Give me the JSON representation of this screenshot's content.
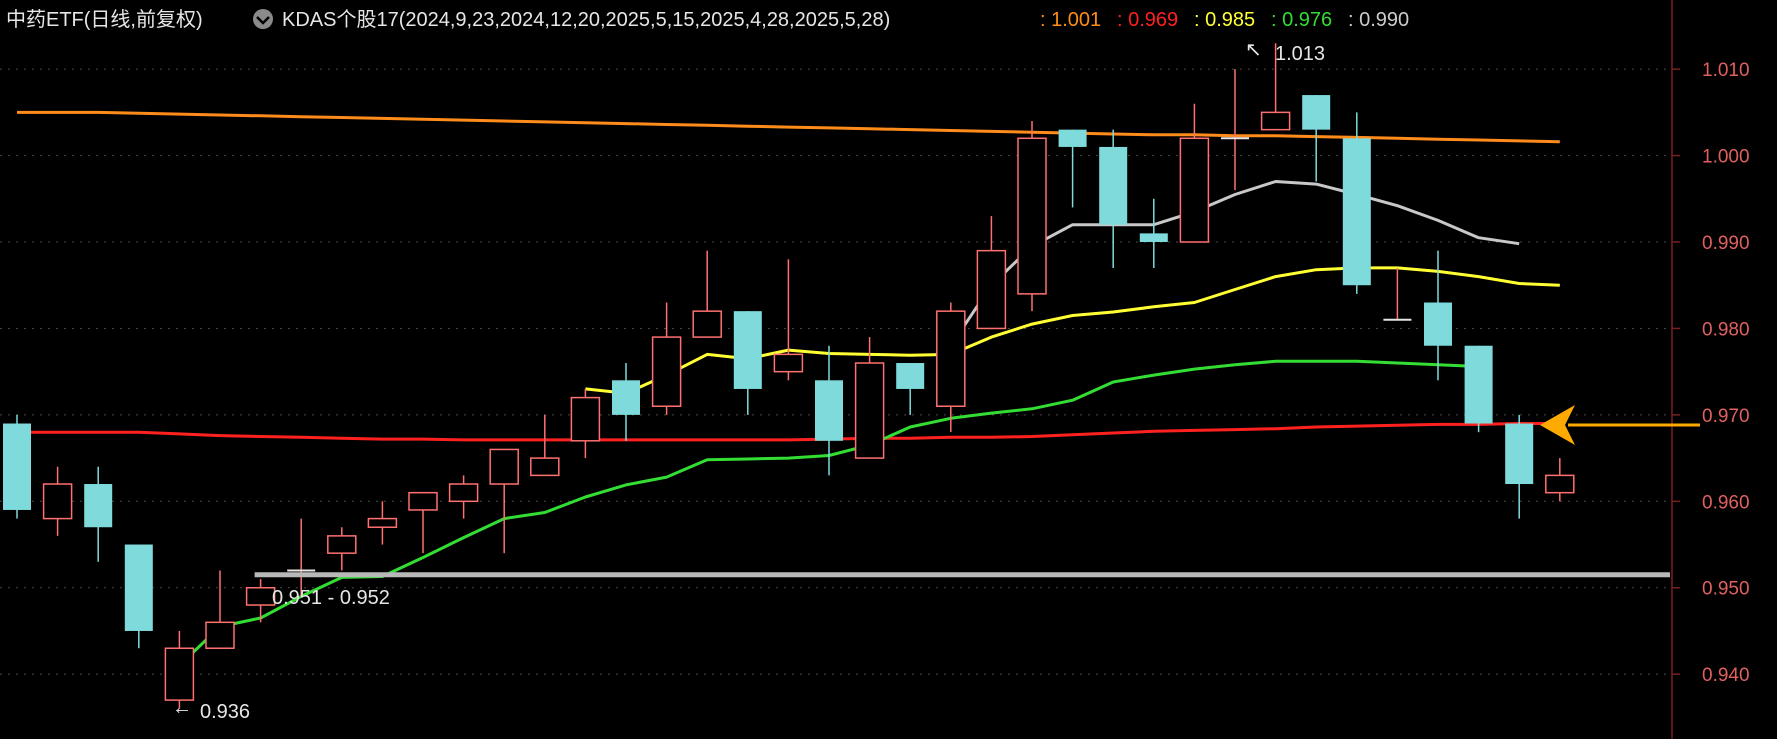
{
  "header": {
    "title": "中药ETF(日线,前复权)",
    "indicator": "KDAS个股17(2024,9,23,2024,12,20,2025,5,15,2025,4,28,2025,5,28)",
    "values": [
      {
        "text": ": 1.001",
        "color": "#ff8c1a"
      },
      {
        "text": ": 0.969",
        "color": "#ff2020"
      },
      {
        "text": ": 0.985",
        "color": "#ffff33"
      },
      {
        "text": ": 0.976",
        "color": "#33dd33"
      },
      {
        "text": ": 0.990",
        "color": "#cccccc"
      }
    ]
  },
  "annotations": {
    "high_label": "1.013",
    "low_label": "0.936",
    "support_label": "0.951 - 0.952"
  },
  "chart_data": {
    "type": "candlestick",
    "ylim": [
      0.9325,
      1.018
    ],
    "y_ticks": [
      "1.010",
      "1.000",
      "0.990",
      "0.980",
      "0.970",
      "0.960",
      "0.950",
      "0.940"
    ],
    "y_tick_values": [
      1.01,
      1.0,
      0.99,
      0.98,
      0.97,
      0.96,
      0.95,
      0.94
    ],
    "colors": {
      "up": "#ff7070",
      "down": "#7fdbdb"
    },
    "candles": [
      {
        "o": 0.969,
        "h": 0.97,
        "l": 0.958,
        "c": 0.959
      },
      {
        "o": 0.958,
        "h": 0.964,
        "l": 0.956,
        "c": 0.962
      },
      {
        "o": 0.962,
        "h": 0.964,
        "l": 0.953,
        "c": 0.957
      },
      {
        "o": 0.955,
        "h": 0.955,
        "l": 0.943,
        "c": 0.945
      },
      {
        "o": 0.937,
        "h": 0.945,
        "l": 0.936,
        "c": 0.943
      },
      {
        "o": 0.943,
        "h": 0.952,
        "l": 0.943,
        "c": 0.946
      },
      {
        "o": 0.948,
        "h": 0.951,
        "l": 0.946,
        "c": 0.95
      },
      {
        "o": 0.952,
        "h": 0.958,
        "l": 0.949,
        "c": 0.952
      },
      {
        "o": 0.954,
        "h": 0.957,
        "l": 0.952,
        "c": 0.956
      },
      {
        "o": 0.957,
        "h": 0.96,
        "l": 0.955,
        "c": 0.958
      },
      {
        "o": 0.959,
        "h": 0.961,
        "l": 0.954,
        "c": 0.961
      },
      {
        "o": 0.96,
        "h": 0.963,
        "l": 0.958,
        "c": 0.962
      },
      {
        "o": 0.962,
        "h": 0.966,
        "l": 0.954,
        "c": 0.966
      },
      {
        "o": 0.963,
        "h": 0.97,
        "l": 0.963,
        "c": 0.965
      },
      {
        "o": 0.967,
        "h": 0.973,
        "l": 0.965,
        "c": 0.972
      },
      {
        "o": 0.974,
        "h": 0.976,
        "l": 0.967,
        "c": 0.97
      },
      {
        "o": 0.971,
        "h": 0.983,
        "l": 0.97,
        "c": 0.979
      },
      {
        "o": 0.979,
        "h": 0.989,
        "l": 0.979,
        "c": 0.982
      },
      {
        "o": 0.982,
        "h": 0.982,
        "l": 0.97,
        "c": 0.973
      },
      {
        "o": 0.975,
        "h": 0.988,
        "l": 0.974,
        "c": 0.977
      },
      {
        "o": 0.974,
        "h": 0.978,
        "l": 0.963,
        "c": 0.967
      },
      {
        "o": 0.965,
        "h": 0.979,
        "l": 0.965,
        "c": 0.976
      },
      {
        "o": 0.976,
        "h": 0.976,
        "l": 0.97,
        "c": 0.973
      },
      {
        "o": 0.971,
        "h": 0.983,
        "l": 0.968,
        "c": 0.982
      },
      {
        "o": 0.98,
        "h": 0.993,
        "l": 0.98,
        "c": 0.989
      },
      {
        "o": 0.984,
        "h": 1.004,
        "l": 0.982,
        "c": 1.002
      },
      {
        "o": 1.003,
        "h": 1.003,
        "l": 0.994,
        "c": 1.001
      },
      {
        "o": 1.001,
        "h": 1.003,
        "l": 0.987,
        "c": 0.992
      },
      {
        "o": 0.991,
        "h": 0.995,
        "l": 0.987,
        "c": 0.99
      },
      {
        "o": 0.99,
        "h": 1.006,
        "l": 0.99,
        "c": 1.002
      },
      {
        "o": 1.002,
        "h": 1.01,
        "l": 0.996,
        "c": 1.002
      },
      {
        "o": 1.003,
        "h": 1.013,
        "l": 1.003,
        "c": 1.005
      },
      {
        "o": 1.007,
        "h": 1.007,
        "l": 0.997,
        "c": 1.003
      },
      {
        "o": 1.002,
        "h": 1.005,
        "l": 0.984,
        "c": 0.985
      },
      {
        "o": 0.981,
        "h": 0.987,
        "l": 0.981,
        "c": 0.981
      },
      {
        "o": 0.983,
        "h": 0.989,
        "l": 0.974,
        "c": 0.978
      },
      {
        "o": 0.978,
        "h": 0.978,
        "l": 0.968,
        "c": 0.969
      },
      {
        "o": 0.969,
        "h": 0.97,
        "l": 0.958,
        "c": 0.962
      },
      {
        "o": 0.961,
        "h": 0.965,
        "l": 0.96,
        "c": 0.963
      }
    ],
    "lines": [
      {
        "color": "#ff8c1a",
        "start": 0,
        "values": [
          1.005,
          1.005,
          1.005,
          1.0049,
          1.0048,
          1.0047,
          1.0046,
          1.0045,
          1.0044,
          1.0043,
          1.0042,
          1.0041,
          1.004,
          1.0039,
          1.0038,
          1.0037,
          1.0036,
          1.0035,
          1.0034,
          1.0033,
          1.0032,
          1.0031,
          1.003,
          1.0029,
          1.0028,
          1.0027,
          1.0026,
          1.0025,
          1.0024,
          1.0024,
          1.0023,
          1.0023,
          1.0022,
          1.0021,
          1.002,
          1.0019,
          1.0018,
          1.0017,
          1.0016
        ]
      },
      {
        "color": "#ff2020",
        "start": 0,
        "values": [
          0.968,
          0.968,
          0.968,
          0.968,
          0.9678,
          0.9676,
          0.9675,
          0.9674,
          0.9673,
          0.9672,
          0.9672,
          0.9671,
          0.9671,
          0.9671,
          0.9671,
          0.9671,
          0.9671,
          0.9671,
          0.9671,
          0.9671,
          0.9672,
          0.9673,
          0.9673,
          0.9674,
          0.9674,
          0.9675,
          0.9677,
          0.9679,
          0.9681,
          0.9682,
          0.9683,
          0.9684,
          0.9686,
          0.9687,
          0.9688,
          0.9689,
          0.9689,
          0.969,
          0.969
        ]
      },
      {
        "color": "#ffff33",
        "start": 14,
        "values": [
          0.973,
          0.9725,
          0.9746,
          0.977,
          0.9765,
          0.9775,
          0.9771,
          0.977,
          0.9769,
          0.977,
          0.979,
          0.9805,
          0.9815,
          0.9819,
          0.9825,
          0.983,
          0.9845,
          0.986,
          0.9868,
          0.987,
          0.987,
          0.9866,
          0.986,
          0.9852,
          0.985
        ]
      },
      {
        "color": "#33dd33",
        "start": 4,
        "values": [
          0.941,
          0.9455,
          0.9465,
          0.949,
          0.9512,
          0.9513,
          0.9535,
          0.9558,
          0.958,
          0.9587,
          0.9605,
          0.9619,
          0.9628,
          0.9648,
          0.9649,
          0.965,
          0.9653,
          0.9665,
          0.9686,
          0.9696,
          0.9702,
          0.9707,
          0.9717,
          0.9738,
          0.9746,
          0.9753,
          0.9758,
          0.9762,
          0.9762,
          0.9762,
          0.976,
          0.9758,
          0.9756
        ]
      },
      {
        "color": "#c8c8c8",
        "start": 23,
        "values": [
          0.978,
          0.985,
          0.9895,
          0.992,
          0.992,
          0.992,
          0.9935,
          0.9955,
          0.997,
          0.9967,
          0.9955,
          0.9942,
          0.9925,
          0.9905,
          0.9898
        ]
      }
    ],
    "support_level": 0.9515
  }
}
